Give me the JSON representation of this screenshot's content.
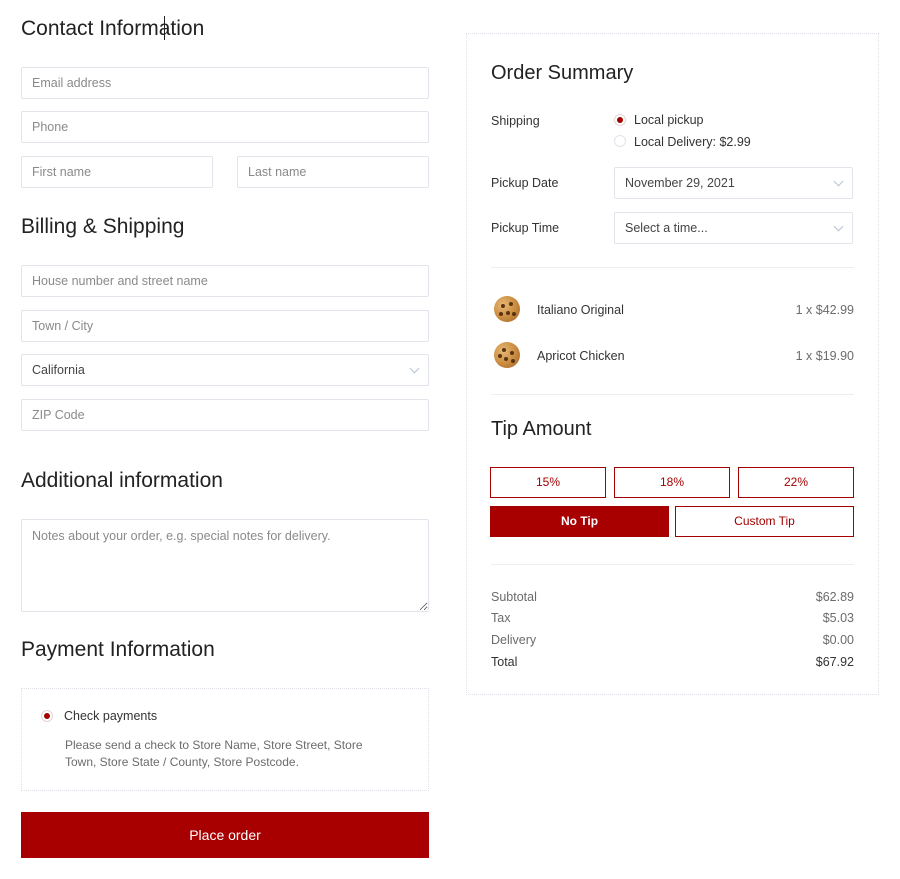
{
  "contact": {
    "title": "Contact Information",
    "email_placeholder": "Email address",
    "phone_placeholder": "Phone",
    "first_name_placeholder": "First name",
    "last_name_placeholder": "Last name"
  },
  "billing": {
    "title": "Billing & Shipping",
    "street_placeholder": "House number and street name",
    "city_placeholder": "Town / City",
    "state_value": "California",
    "zip_placeholder": "ZIP Code"
  },
  "additional": {
    "title": "Additional information",
    "notes_placeholder": "Notes about your order, e.g. special notes for delivery."
  },
  "payment": {
    "title": "Payment Information",
    "method_label": "Check payments",
    "method_selected": true,
    "description": "Please send a check to Store Name, Store Street, Store Town, Store State / County, Store Postcode.",
    "place_order_label": "Place order"
  },
  "summary": {
    "title": "Order Summary",
    "shipping_label": "Shipping",
    "shipping_options": [
      {
        "label": "Local pickup",
        "selected": true
      },
      {
        "label": "Local Delivery: $2.99",
        "selected": false
      }
    ],
    "pickup_date_label": "Pickup Date",
    "pickup_date_value": "November 29, 2021",
    "pickup_time_label": "Pickup Time",
    "pickup_time_value": "Select a time...",
    "items": [
      {
        "name": "Italiano Original",
        "qty_price": "1 x $42.99",
        "icon": "cookie-icon"
      },
      {
        "name": "Apricot Chicken",
        "qty_price": "1 x $19.90",
        "icon": "cookie-icon"
      }
    ]
  },
  "tip": {
    "title": "Tip Amount",
    "options": [
      "15%",
      "18%",
      "22%"
    ],
    "no_tip_label": "No Tip",
    "custom_tip_label": "Custom Tip",
    "selected": "No Tip"
  },
  "totals": {
    "subtotal_label": "Subtotal",
    "subtotal_value": "$62.89",
    "tax_label": "Tax",
    "tax_value": "$5.03",
    "delivery_label": "Delivery",
    "delivery_value": "$0.00",
    "total_label": "Total",
    "total_value": "$67.92"
  },
  "colors": {
    "accent": "#a80000",
    "border": "#e1e4ea",
    "text": "#333333"
  }
}
